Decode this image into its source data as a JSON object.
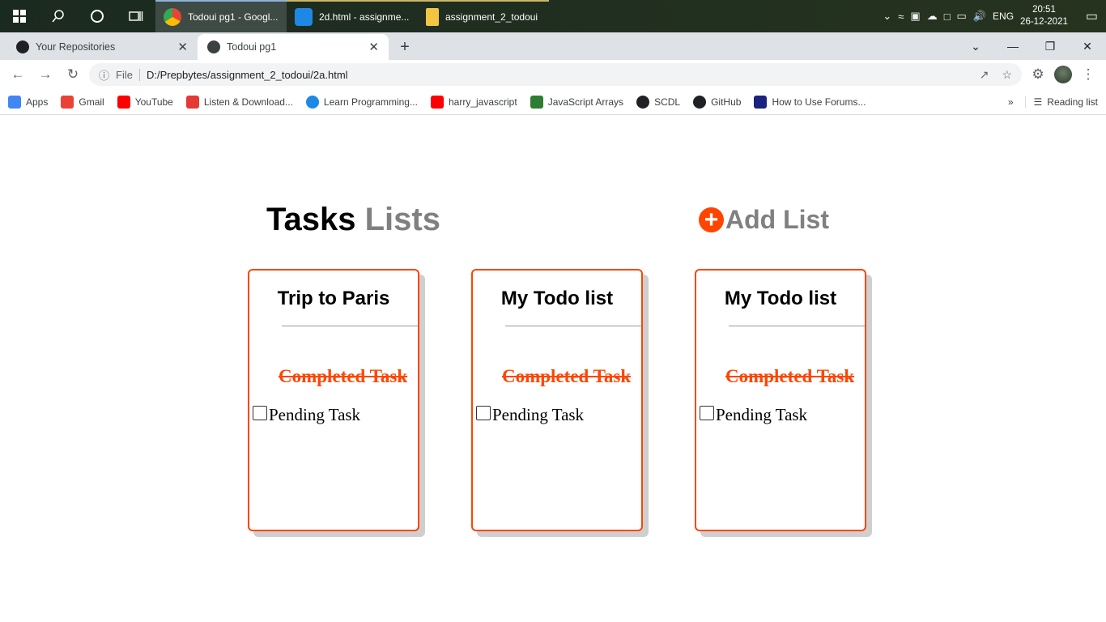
{
  "taskbar": {
    "apps": [
      {
        "label": "Todoui pg1 - Googl...",
        "icon": "chrome-icon"
      },
      {
        "label": "2d.html - assignme...",
        "icon": "vscode-icon"
      },
      {
        "label": "assignment_2_todoui",
        "icon": "folder-icon"
      }
    ],
    "language": "ENG",
    "time": "20:51",
    "date": "26-12-2021"
  },
  "browser": {
    "tabs": [
      {
        "label": "Your Repositories",
        "icon": "github-icon"
      },
      {
        "label": "Todoui pg1",
        "icon": "globe-icon"
      }
    ],
    "address": {
      "scheme_label": "File",
      "url": "D:/Prepbytes/assignment_2_todoui/2a.html"
    },
    "bookmarks": [
      {
        "label": "Apps",
        "color": "#4285f4"
      },
      {
        "label": "Gmail",
        "color": "#ea4335"
      },
      {
        "label": "YouTube",
        "color": "#ff0000"
      },
      {
        "label": "Listen & Download...",
        "color": "#e53935"
      },
      {
        "label": "Learn Programming...",
        "color": "#1e88e5"
      },
      {
        "label": "harry_javascript",
        "color": "#ff0000"
      },
      {
        "label": "JavaScript Arrays",
        "color": "#2e7d32"
      },
      {
        "label": "SCDL",
        "color": "#202124"
      },
      {
        "label": "GitHub",
        "color": "#202124"
      },
      {
        "label": "How to Use Forums...",
        "color": "#1a237e"
      }
    ],
    "reading_list": "Reading list"
  },
  "page": {
    "heading": {
      "bold": "Tasks",
      "muted": "Lists"
    },
    "add_list_label": "Add List",
    "accent_color": "#ff4500",
    "cards": [
      {
        "title": "Trip to Paris",
        "completed_task": "Completed Task",
        "pending_task": "Pending Task"
      },
      {
        "title": "My Todo list",
        "completed_task": "Completed Task",
        "pending_task": "Pending Task"
      },
      {
        "title": "My Todo list",
        "completed_task": "Completed Task",
        "pending_task": "Pending Task"
      }
    ]
  }
}
